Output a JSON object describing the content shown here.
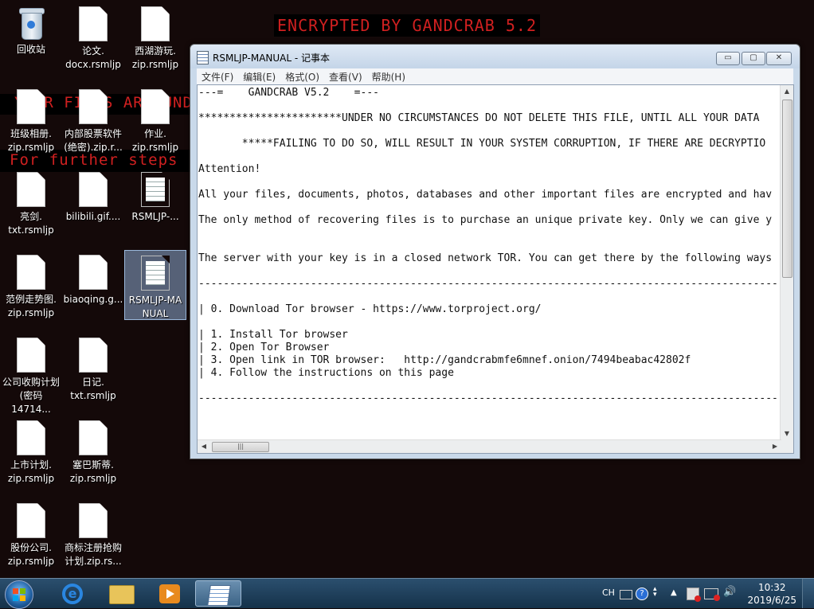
{
  "wallpaper": {
    "title": "ENCRYPTED BY GANDCRAB 5.2",
    "line1": "YOUR FILES ARE UNDER",
    "line2": "For further steps read"
  },
  "desktop_icons": [
    {
      "label": "回收站"
    },
    {
      "label": "论文.\ndocx.rsmljp"
    },
    {
      "label": "西湖游玩.\nzip.rsmljp"
    },
    {
      "label": "班级相册.\nzip.rsmljp"
    },
    {
      "label": "内部股票软件\n(绝密).zip.r..."
    },
    {
      "label": "作业.\nzip.rsmljp"
    },
    {
      "label": "亮剑.\ntxt.rsmljp"
    },
    {
      "label": "bilibili.gif...."
    },
    {
      "label": "RSMLJP-..."
    },
    {
      "label": "范例走势图.\nzip.rsmljp"
    },
    {
      "label": "biaoqing.g..."
    },
    {
      "label": "RSMLJP-MA\nNUAL"
    },
    {
      "label": "公司收购计划\n(密码14714..."
    },
    {
      "label": "日记.\ntxt.rsmljp"
    },
    {
      "label": "上市计划.\nzip.rsmljp"
    },
    {
      "label": "塞巴斯蒂.\nzip.rsmljp"
    },
    {
      "label": "股份公司.\nzip.rsmljp"
    },
    {
      "label": "商标注册抢购\n计划.zip.rs..."
    }
  ],
  "window": {
    "title": "RSMLJP-MANUAL - 记事本",
    "minimize": "▭",
    "maximize": "▢",
    "close": "✕",
    "menu": [
      "文件(F)",
      "编辑(E)",
      "格式(O)",
      "查看(V)",
      "帮助(H)"
    ],
    "content": "---=    GANDCRAB V5.2    =---\n\n***********************UNDER NO CIRCUMSTANCES DO NOT DELETE THIS FILE, UNTIL ALL YOUR DATA\n\n       *****FAILING TO DO SO, WILL RESULT IN YOUR SYSTEM CORRUPTION, IF THERE ARE DECRYPTIO\n\nAttention!\n\nAll your files, documents, photos, databases and other important files are encrypted and hav\n\nThe only method of recovering files is to purchase an unique private key. Only we can give y\n\n\nThe server with your key is in a closed network TOR. You can get there by the following ways\n\n---------------------------------------------------------------------------------------------\n\n| 0. Download Tor browser - https://www.torproject.org/\n\n| 1. Install Tor browser\n| 2. Open Tor Browser\n| 3. Open link in TOR browser:   http://gandcrabmfe6mnef.onion/7494beabac42802f\n| 4. Follow the instructions on this page\n\n---------------------------------------------------------------------------------------------",
    "hscroll_grip": "|||"
  },
  "taskbar": {
    "ie_glyph": "e",
    "lang": "CH",
    "time": "10:32",
    "date": "2019/6/25"
  },
  "colors": {
    "wallpaper_text": "#d02020",
    "desktop_bg": "#140909"
  }
}
